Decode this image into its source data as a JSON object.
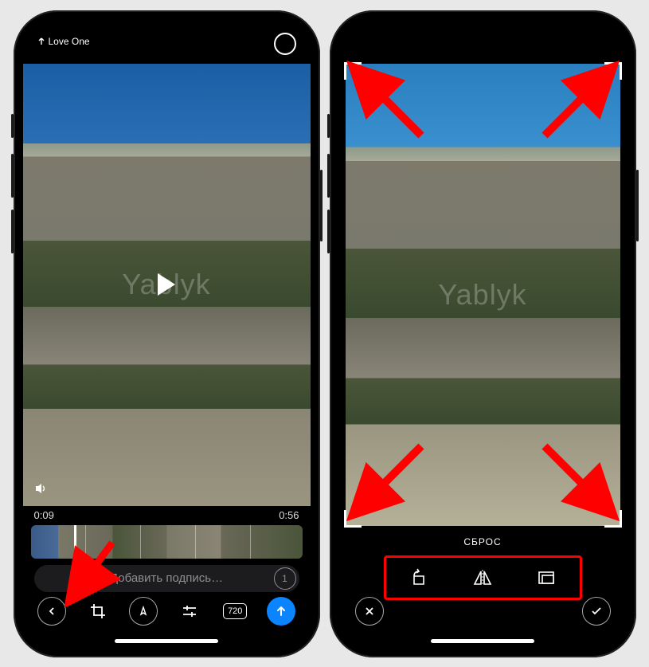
{
  "watermark": "Yablyk",
  "left": {
    "back_label": "Love One",
    "time_current": "0:09",
    "time_end": "0:56",
    "caption_placeholder": "Добавить подпись…",
    "quality_label": "720",
    "timer_label": "1"
  },
  "right": {
    "reset_label": "СБРОС"
  },
  "annotation_color": "#ff0000"
}
